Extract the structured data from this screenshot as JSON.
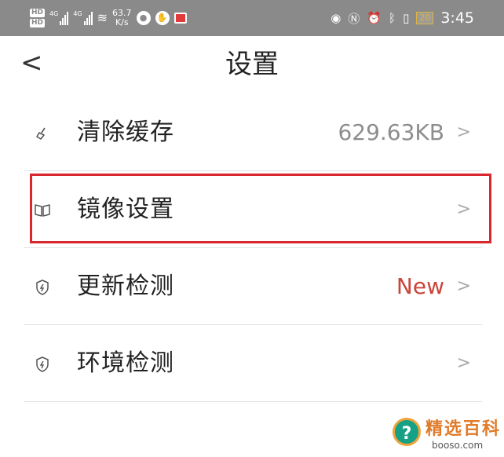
{
  "statusbar": {
    "hd_top": "HD",
    "hd_bottom": "HD",
    "sim1_label": "4G",
    "sim2_label": "4G",
    "speed_value": "63.7",
    "speed_unit": "K/s",
    "battery": "20",
    "time": "3:45",
    "icons": [
      "hd-icon",
      "signal-icon",
      "wifi-icon",
      "globe-icon",
      "hand-icon",
      "notification-icon",
      "eye-icon",
      "nfc-icon",
      "alarm-icon",
      "bluetooth-icon",
      "vibrate-icon",
      "battery-icon"
    ]
  },
  "header": {
    "back": "<",
    "title": "设置"
  },
  "rows": [
    {
      "label": "清除缓存",
      "value": "629.63KB",
      "icon": "broom-icon",
      "chevron": ">"
    },
    {
      "label": "镜像设置",
      "value": "",
      "icon": "mirror-icon",
      "chevron": ">"
    },
    {
      "label": "更新检测",
      "value": "New",
      "icon": "shield-icon",
      "chevron": ">"
    },
    {
      "label": "环境检测",
      "value": "",
      "icon": "shield-icon",
      "chevron": ">"
    }
  ],
  "watermark": {
    "brand": "精选百科",
    "url": "booso.com",
    "mark": "?"
  },
  "colors": {
    "statusbar_bg": "#8a8a8a",
    "highlight": "#d8272d",
    "new_badge": "#c9453a"
  }
}
